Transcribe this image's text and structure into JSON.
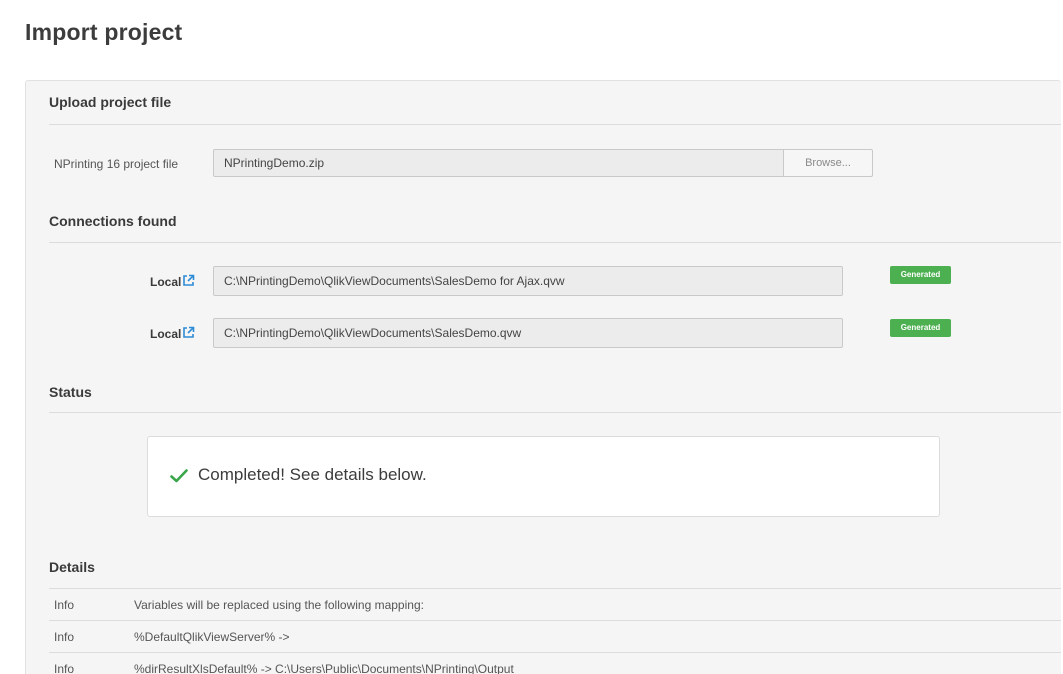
{
  "page": {
    "title": "Import project"
  },
  "upload": {
    "section_title": "Upload project file",
    "field_label": "NPrinting 16 project file",
    "file_value": "NPrintingDemo.zip",
    "browse_label": "Browse..."
  },
  "connections": {
    "section_title": "Connections found",
    "items": [
      {
        "label": "Local",
        "path": "C:\\NPrintingDemo\\QlikViewDocuments\\SalesDemo for Ajax.qvw",
        "badge": "Generated"
      },
      {
        "label": "Local",
        "path": "C:\\NPrintingDemo\\QlikViewDocuments\\SalesDemo.qvw",
        "badge": "Generated"
      }
    ]
  },
  "status": {
    "section_title": "Status",
    "message": "Completed! See details below."
  },
  "details": {
    "section_title": "Details",
    "rows": [
      {
        "type": "Info",
        "message": "Variables will be replaced using the following mapping:"
      },
      {
        "type": "Info",
        "message": "%DefaultQlikViewServer% ->"
      },
      {
        "type": "Info",
        "message": "%dirResultXlsDefault% -> C:\\Users\\Public\\Documents\\NPrinting\\Output"
      }
    ]
  },
  "colors": {
    "badge_green": "#4caf50",
    "icon_blue": "#2e8bd6",
    "check_green": "#3aa64a"
  }
}
